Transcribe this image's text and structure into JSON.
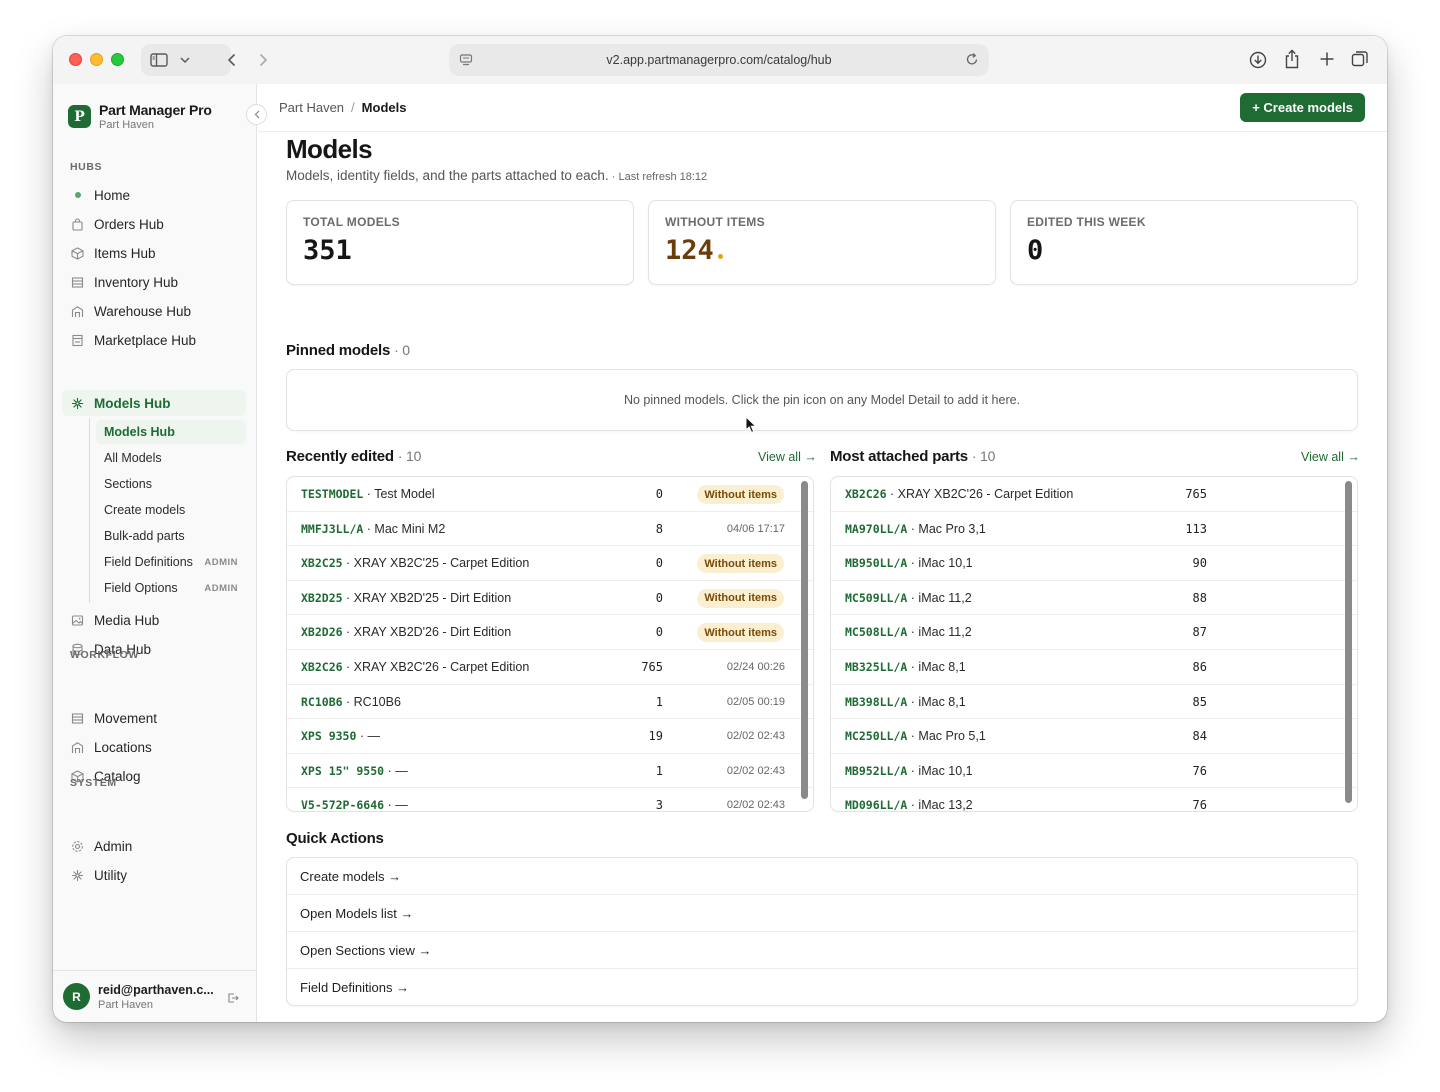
{
  "browser": {
    "url": "v2.app.partmanagerpro.com/catalog/hub"
  },
  "brand": {
    "name": "Part Manager Pro",
    "org": "Part Haven",
    "logo_letter": "P"
  },
  "sidebar": {
    "sections": {
      "hubs": "HUBS",
      "workflow": "WORKFLOW",
      "system": "SYSTEM"
    },
    "hubs": [
      {
        "label": "Home",
        "icon": "dot-icon"
      },
      {
        "label": "Orders Hub",
        "icon": "bag-icon"
      },
      {
        "label": "Items Hub",
        "icon": "cube-icon"
      },
      {
        "label": "Inventory Hub",
        "icon": "stack-icon"
      },
      {
        "label": "Warehouse Hub",
        "icon": "warehouse-icon"
      },
      {
        "label": "Marketplace Hub",
        "icon": "store-icon"
      },
      {
        "label": "Models Hub",
        "icon": "sparkle-icon"
      }
    ],
    "models_sub": [
      {
        "label": "Models Hub"
      },
      {
        "label": "All Models"
      },
      {
        "label": "Sections"
      },
      {
        "label": "Create models"
      },
      {
        "label": "Bulk-add parts"
      },
      {
        "label": "Field Definitions",
        "tag": "ADMIN"
      },
      {
        "label": "Field Options",
        "tag": "ADMIN"
      }
    ],
    "hubs_after": [
      {
        "label": "Media Hub",
        "icon": "image-icon"
      },
      {
        "label": "Data Hub",
        "icon": "database-icon"
      }
    ],
    "workflow": [
      {
        "label": "Movement",
        "icon": "stack-icon"
      },
      {
        "label": "Locations",
        "icon": "warehouse-icon"
      },
      {
        "label": "Catalog",
        "icon": "cube-icon"
      }
    ],
    "system": [
      {
        "label": "Admin",
        "icon": "gear-icon"
      },
      {
        "label": "Utility",
        "icon": "sparkle-icon"
      }
    ],
    "user": {
      "initial": "R",
      "email": "reid@parthaven.c...",
      "org": "Part Haven"
    }
  },
  "topbar": {
    "breadcrumb": [
      "Part Haven",
      "/",
      "Models"
    ],
    "create_button": "+ Create models"
  },
  "page": {
    "title": "Models",
    "description": "Models, identity fields, and the parts attached to each.",
    "refresh": " · Last refresh 18:12"
  },
  "stats": [
    {
      "label": "TOTAL MODELS",
      "value": "351"
    },
    {
      "label": "WITHOUT ITEMS",
      "value": "124",
      "accent": "#e0a21a"
    },
    {
      "label": "EDITED THIS WEEK",
      "value": "0"
    }
  ],
  "pinned": {
    "title": "Pinned models",
    "count": "· 0",
    "empty": "No pinned models. Click the pin icon on any Model Detail to add it here."
  },
  "recent": {
    "title": "Recently edited",
    "count": "· 10",
    "view_all": "View all →",
    "rows": [
      {
        "pn": "TESTMODEL",
        "name": " · Test Model",
        "count": "0",
        "status": "Without items"
      },
      {
        "pn": "MMFJ3LL/A",
        "name": " · Mac Mini M2",
        "count": "8",
        "date": "04/06 17:17"
      },
      {
        "pn": "XB2C25",
        "name": " · XRAY XB2C'25 - Carpet Edition",
        "count": "0",
        "status": "Without items"
      },
      {
        "pn": "XB2D25",
        "name": " · XRAY XB2D'25 - Dirt Edition",
        "count": "0",
        "status": "Without items"
      },
      {
        "pn": "XB2D26",
        "name": " · XRAY XB2D'26 - Dirt Edition",
        "count": "0",
        "status": "Without items"
      },
      {
        "pn": "XB2C26",
        "name": " · XRAY XB2C'26 - Carpet Edition",
        "count": "765",
        "date": "02/24 00:26"
      },
      {
        "pn": "RC10B6",
        "name": " · RC10B6",
        "count": "1",
        "date": "02/05 00:19"
      },
      {
        "pn": "XPS 9350",
        "name": " · —",
        "count": "19",
        "date": "02/02 02:43"
      },
      {
        "pn": "XPS 15\" 9550",
        "name": " · —",
        "count": "1",
        "date": "02/02 02:43"
      },
      {
        "pn": "V5-572P-6646",
        "name": " · —",
        "count": "3",
        "date": "02/02 02:43"
      }
    ]
  },
  "attached": {
    "title": "Most attached parts",
    "count": "· 10",
    "view_all": "View all →",
    "rows": [
      {
        "pn": "XB2C26",
        "name": " · XRAY XB2C'26 - Carpet Edition",
        "count": "765"
      },
      {
        "pn": "MA970LL/A",
        "name": " · Mac Pro 3,1",
        "count": "113"
      },
      {
        "pn": "MB950LL/A",
        "name": " · iMac 10,1",
        "count": "90"
      },
      {
        "pn": "MC509LL/A",
        "name": " · iMac 11,2",
        "count": "88"
      },
      {
        "pn": "MC508LL/A",
        "name": " · iMac 11,2",
        "count": "87"
      },
      {
        "pn": "MB325LL/A",
        "name": " · iMac 8,1",
        "count": "86"
      },
      {
        "pn": "MB398LL/A",
        "name": " · iMac 8,1",
        "count": "85"
      },
      {
        "pn": "MC250LL/A",
        "name": " · Mac Pro 5,1",
        "count": "84"
      },
      {
        "pn": "MB952LL/A",
        "name": " · iMac 10,1",
        "count": "76"
      },
      {
        "pn": "MD096LL/A",
        "name": " · iMac 13,2",
        "count": "76"
      }
    ]
  },
  "quick_actions": {
    "title": "Quick Actions",
    "items": [
      "Create models →",
      "Open Models list →",
      "Open Sections view →",
      "Field Definitions →"
    ]
  },
  "colors": {
    "brand_green": "#1e6b33",
    "warn_badge_bg": "#fbefd2",
    "warn_badge_text": "#7a4a06"
  }
}
